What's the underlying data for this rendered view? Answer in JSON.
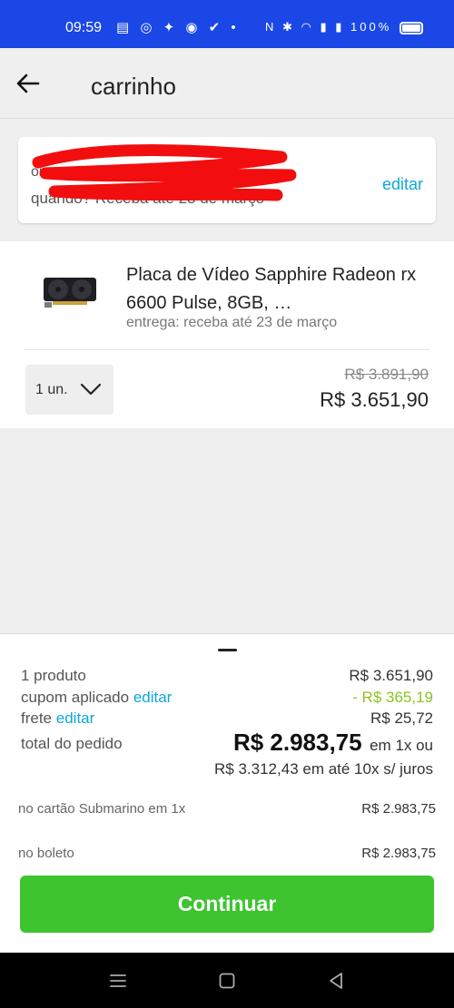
{
  "status_bar": {
    "time": "09:59",
    "left_icons": "▤ ◎ ✦ ◉ ✔ •",
    "right_icons": "N ✱ ◠ ▮ ▮",
    "battery": "100%"
  },
  "header": {
    "back_icon": "arrow-left-icon",
    "title": "carrinho"
  },
  "address": {
    "line1": "on",
    "line2": "quando? Receba até 23 de março",
    "edit_label": "editar"
  },
  "product": {
    "name": "Placa de Vídeo Sapphire Radeon rx 6600 Pulse, 8GB, …",
    "delivery": "entrega: receba até 23 de março",
    "quantity": "1 un.",
    "price_old": "R$ 3.891,90",
    "price_new": "R$ 3.651,90"
  },
  "summary": {
    "products_label": "1 produto",
    "products_value": "R$ 3.651,90",
    "coupon_label": "cupom aplicado",
    "coupon_edit": "editar",
    "coupon_value": "- R$ 365,19",
    "shipping_label": "frete",
    "shipping_edit": "editar",
    "shipping_value": "R$ 25,72",
    "total_label": "total do pedido",
    "total_value": "R$ 2.983,75",
    "total_suffix": "em 1x ou",
    "installments": "R$ 3.312,43 em até 10x s/ juros",
    "card_label": "no cartão Submarino em 1x",
    "card_value": "R$ 2.983,75",
    "boleto_label": "no boleto",
    "boleto_value": "R$ 2.983,75",
    "continue_label": "Continuar"
  },
  "colors": {
    "status_bar": "#1a47e6",
    "link": "#0fa6d6",
    "discount": "#8dc21f",
    "primary_button": "#3dc42f"
  }
}
